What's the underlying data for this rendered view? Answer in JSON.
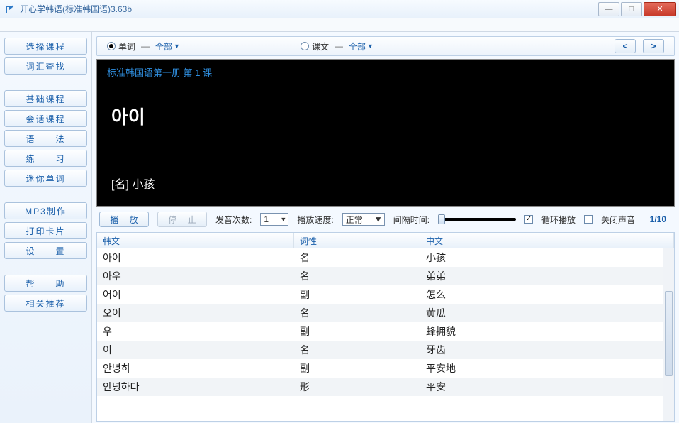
{
  "window": {
    "title": "开心学韩语(标准韩国语)3.63b",
    "minimize": "—",
    "maximize": "□",
    "close": "✕"
  },
  "sidebar": {
    "items": [
      "选择课程",
      "词汇查找",
      "",
      "基础课程",
      "会话课程",
      "语　　法",
      "练　　习",
      "迷你单词",
      "",
      "MP3制作",
      "打印卡片",
      "设　　置",
      "",
      "帮　　助",
      "相关推荐"
    ]
  },
  "filter": {
    "mode1_label": "单词",
    "mode1_scope": "全部",
    "mode2_label": "课文",
    "mode2_scope": "全部",
    "prev": "<",
    "next": ">"
  },
  "display": {
    "lesson": "标准韩国语第一册 第 1 课",
    "kword": "아이",
    "meaning": "[名]  小孩"
  },
  "controls": {
    "play": "播  放",
    "stop": "停  止",
    "count_label": "发音次数:",
    "count_value": "1",
    "speed_label": "播放速度:",
    "speed_value": "正常",
    "interval_label": "间隔时间:",
    "loop_label": "循环播放",
    "mute_label": "关闭声音",
    "counter": "1/10"
  },
  "table": {
    "headers": {
      "c1": "韩文",
      "c2": "词性",
      "c3": "中文"
    },
    "rows": [
      {
        "c1": "아이",
        "c2": "名",
        "c3": "小孩"
      },
      {
        "c1": "아우",
        "c2": "名",
        "c3": "弟弟"
      },
      {
        "c1": "어이",
        "c2": "副",
        "c3": "怎么"
      },
      {
        "c1": "오이",
        "c2": "名",
        "c3": "黄瓜"
      },
      {
        "c1": "우",
        "c2": "副",
        "c3": "蜂拥貌"
      },
      {
        "c1": "이",
        "c2": "名",
        "c3": "牙齿"
      },
      {
        "c1": "안녕히",
        "c2": "副",
        "c3": "平安地"
      },
      {
        "c1": "안녕하다",
        "c2": "形",
        "c3": "平安"
      }
    ]
  }
}
